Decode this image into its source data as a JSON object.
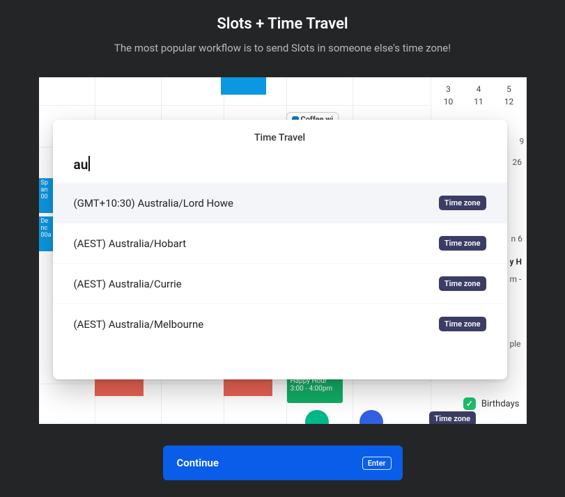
{
  "header": {
    "title": "Slots + Time Travel",
    "subtitle": "The most popular workflow is to send Slots in someone else's time zone!"
  },
  "calendar_bg": {
    "coffee_label": "Coffee wi",
    "side_event_a_line1": "Sp",
    "side_event_a_line2": "an",
    "side_event_a_line3": "00",
    "side_event_b_line1": "De",
    "side_event_b_line2": "nc",
    "side_event_b_line3": "00a",
    "happy_hour_line1": "Happy Hour",
    "happy_hour_line2": "3:00 - 4:00pm",
    "mini_cal_row1": [
      "3",
      "4",
      "5"
    ],
    "mini_cal_row2": [
      "10",
      "11",
      "12"
    ],
    "right_frag_1": "9",
    "right_frag_2": "26",
    "right_frag_3": "n 6",
    "right_frag_4": "y H",
    "right_frag_5": "m -",
    "right_frag_6": "ple",
    "birthdays_label": "Birthdays"
  },
  "modal": {
    "title": "Time Travel",
    "search_value": "au",
    "badge_label": "Time zone",
    "items": [
      "(GMT+10:30) Australia/Lord Howe",
      "(AEST) Australia/Hobart",
      "(AEST) Australia/Currie",
      "(AEST) Australia/Melbourne"
    ]
  },
  "footer": {
    "continue_label": "Continue",
    "key_hint": "Enter"
  }
}
